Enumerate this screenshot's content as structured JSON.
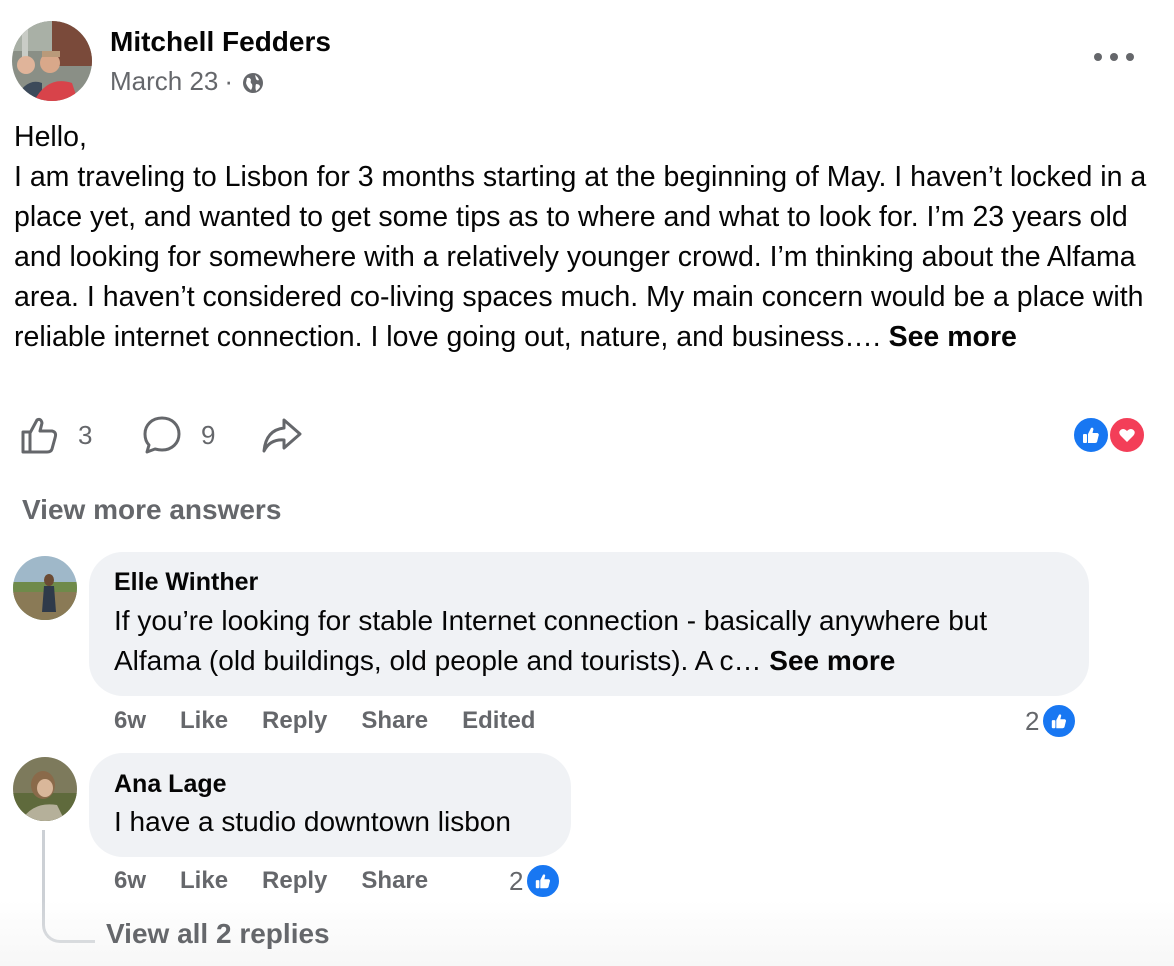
{
  "post": {
    "author": "Mitchell Fedders",
    "date": "March 23",
    "separator": "·",
    "privacy_icon": "globe-icon",
    "more_icon": "more-horizontal-icon",
    "body_lines": [
      "Hello,",
      "I am traveling to Lisbon for 3 months starting at the beginning of May. I haven’t locked in a place yet, and wanted to get some tips as to where and what to look for. I’m 23 years old and looking for somewhere with a relatively younger crowd. I’m thinking about the Alfama area. I haven’t considered co-living spaces much. My main concern would be a place with reliable internet connection. I love going out, nature, and business…."
    ],
    "see_more": "See more",
    "actions": {
      "like_count": "3",
      "comment_count": "9"
    },
    "reactions": [
      "like",
      "love"
    ]
  },
  "comments_section": {
    "view_more_answers": "View more answers",
    "comments": [
      {
        "author": "Elle Winther",
        "text": "If you’re looking for stable Internet connection - basically anywhere but Alfama (old buildings, old people and tourists). A c…",
        "see_more": "See more",
        "time": "6w",
        "like": "Like",
        "reply": "Reply",
        "share": "Share",
        "edited": "Edited",
        "reaction_count": "2"
      },
      {
        "author": "Ana Lage",
        "text": "I have a studio downtown lisbon",
        "time": "6w",
        "like": "Like",
        "reply": "Reply",
        "share": "Share",
        "reaction_count": "2"
      }
    ],
    "view_replies": "View all 2 replies"
  },
  "colors": {
    "primary_text": "#050505",
    "secondary_text": "#65676b",
    "bubble": "#f0f2f5",
    "like_blue": "#1877f2",
    "love_red": "#f33e58"
  }
}
